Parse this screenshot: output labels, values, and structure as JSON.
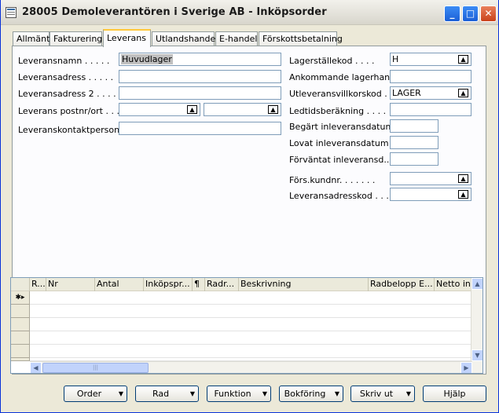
{
  "window": {
    "title": "28005 Demoleverantören i Sverige AB - Inköpsorder"
  },
  "tabs": [
    "Allmänt",
    "Fakturering",
    "Leverans",
    "Utlandshandel",
    "E-handel",
    "Förskottsbetalning"
  ],
  "left": {
    "labels": [
      "Leveransnamn . . . . .",
      "Leveransadress . . . . .",
      "Leveransadress 2 . . . .",
      "Leverans postnr/ort . . .",
      "Leveranskontaktperson ."
    ],
    "ship_name": "Huvudlager",
    "ship_address": "",
    "ship_address2": "",
    "ship_postcode": "",
    "ship_city": "",
    "ship_contact": ""
  },
  "right": {
    "labels": [
      "Lagerställekod . . . .",
      "Ankommande lagerhan...",
      "Utleveransvillkorskod .",
      "Ledtidsberäkning . . . .",
      "Begärt inleveransdatum .",
      "Lovat inleveransdatum .",
      "Förväntat inleveransd...",
      "Förs.kundnr. . . . . . .",
      "Leveransadresskod . . ."
    ],
    "location_code": "H",
    "inbound_whse": "",
    "shipment_method": "LAGER",
    "lead_time": "",
    "requested_date": "",
    "promised_date": "",
    "expected_date": "",
    "sell_to_customer": "",
    "ship_to_code": ""
  },
  "lines": {
    "headers": [
      "R...",
      "Nr",
      "Antal",
      "Inköpspr...",
      "¶",
      "Radr...",
      "Beskrivning",
      "Radbelopp E...",
      "Netto inkö"
    ],
    "new_row_marker": "✱▸"
  },
  "buttons": {
    "order": "Order",
    "rad": "Rad",
    "funktion": "Funktion",
    "bokforing": "Bokföring",
    "skriv_ut": "Skriv ut",
    "hjalp": "Hjälp"
  },
  "icons": {
    "lookup": "lookup-arrow-icon",
    "dropdown": "dropdown-arrow-icon"
  }
}
